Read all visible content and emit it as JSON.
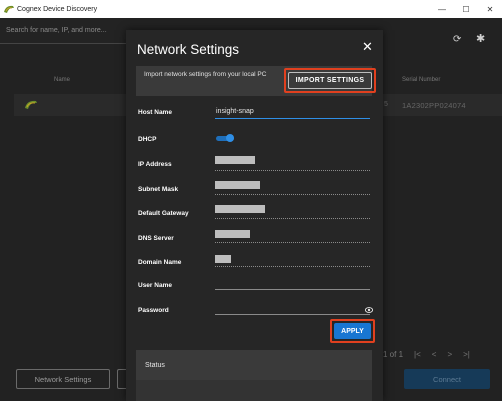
{
  "window": {
    "title": "Cognex Device Discovery",
    "minimize": "—",
    "maximize": "☐",
    "close": "✕"
  },
  "background": {
    "search_placeholder": "Search for name, IP, and more...",
    "refresh_icon": "refresh-icon",
    "settings_icon": "gear-icon",
    "columns": [
      "Name",
      "Serial Number"
    ],
    "row": {
      "ip_fragment": "5",
      "serial": "1A2302PP024074"
    },
    "network_settings_button": "Network Settings",
    "pager": [
      "1 of 1",
      "|<",
      "<",
      ">",
      ">|"
    ],
    "connect_button": "Connect"
  },
  "dialog": {
    "title": "Network Settings",
    "close_icon": "✕",
    "import_text": "Import network settings from your local PC",
    "import_button": "IMPORT SETTINGS",
    "fields": {
      "host_name_label": "Host Name",
      "host_name_value": "insight-snap",
      "dhcp_label": "DHCP",
      "dhcp_enabled": true,
      "ip_label": "IP Address",
      "subnet_label": "Subnet Mask",
      "gateway_label": "Default Gateway",
      "dns_label": "DNS Server",
      "domain_label": "Domain Name",
      "user_label": "User Name",
      "password_label": "Password"
    },
    "apply_button": "APPLY",
    "status_label": "Status"
  },
  "colors": {
    "accent_blue": "#1976d2",
    "highlight_red": "#e0401f",
    "dialog_bg": "#262626"
  }
}
